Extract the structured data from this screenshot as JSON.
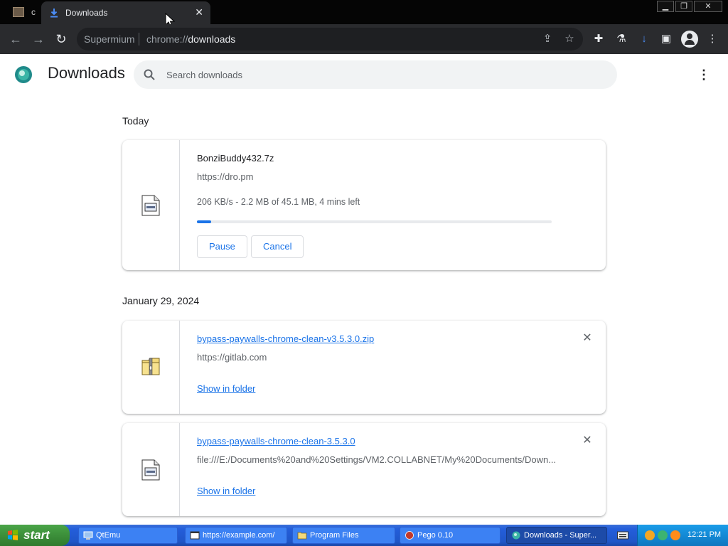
{
  "browser": {
    "inactive_tab_label": "c",
    "active_tab": {
      "title": "Downloads",
      "close_glyph": "✕"
    },
    "window_buttons": {
      "minimize": "▁",
      "restore": "❐",
      "close": "✕"
    },
    "omnibox": {
      "site_label": "Supermium",
      "url_scheme": "chrome://",
      "url_path": "downloads"
    },
    "toolbar_icons": [
      "back-icon",
      "forward-icon",
      "reload-icon",
      "share-icon",
      "star-icon",
      "extensions-icon",
      "labs-icon",
      "download-icon",
      "sidepanel-icon",
      "profile-icon"
    ]
  },
  "page": {
    "title": "Downloads",
    "search_placeholder": "Search downloads",
    "menu_glyph": "⋮"
  },
  "sections": {
    "today": "Today",
    "earlier": "January 29, 2024"
  },
  "downloads": [
    {
      "file_name": "BonziBuddy432.7z",
      "source": "https://dro.pm",
      "status": "206 KB/s - 2.2 MB of 45.1 MB, 4 mins left",
      "progress_fraction": 0.04,
      "pause_label": "Pause",
      "cancel_label": "Cancel",
      "icon": "file-icon"
    },
    {
      "file_name": "bypass-paywalls-chrome-clean-v3.5.3.0.zip",
      "source": "https://gitlab.com",
      "show_in_folder": "Show in folder",
      "remove_glyph": "✕",
      "icon": "zip-folder-icon"
    },
    {
      "file_name": "bypass-paywalls-chrome-clean-3.5.3.0",
      "source": "file:///E:/Documents%20and%20Settings/VM2.COLLABNET/My%20Documents/Down...",
      "show_in_folder": "Show in folder",
      "remove_glyph": "✕",
      "icon": "file-icon"
    }
  ],
  "taskbar": {
    "start_label": "start",
    "tasks": [
      "QtEmu",
      "https://example.com/",
      "Program Files",
      "Pego 0.10",
      "Downloads - Super..."
    ],
    "clock": "12:21 PM"
  },
  "colors": {
    "accent": "#1a73e8",
    "toolbar_bg": "#2a2b2e",
    "titlebar_bg": "#050505",
    "taskbar_blue": "#245edb",
    "start_green": "#3c8f3a"
  }
}
